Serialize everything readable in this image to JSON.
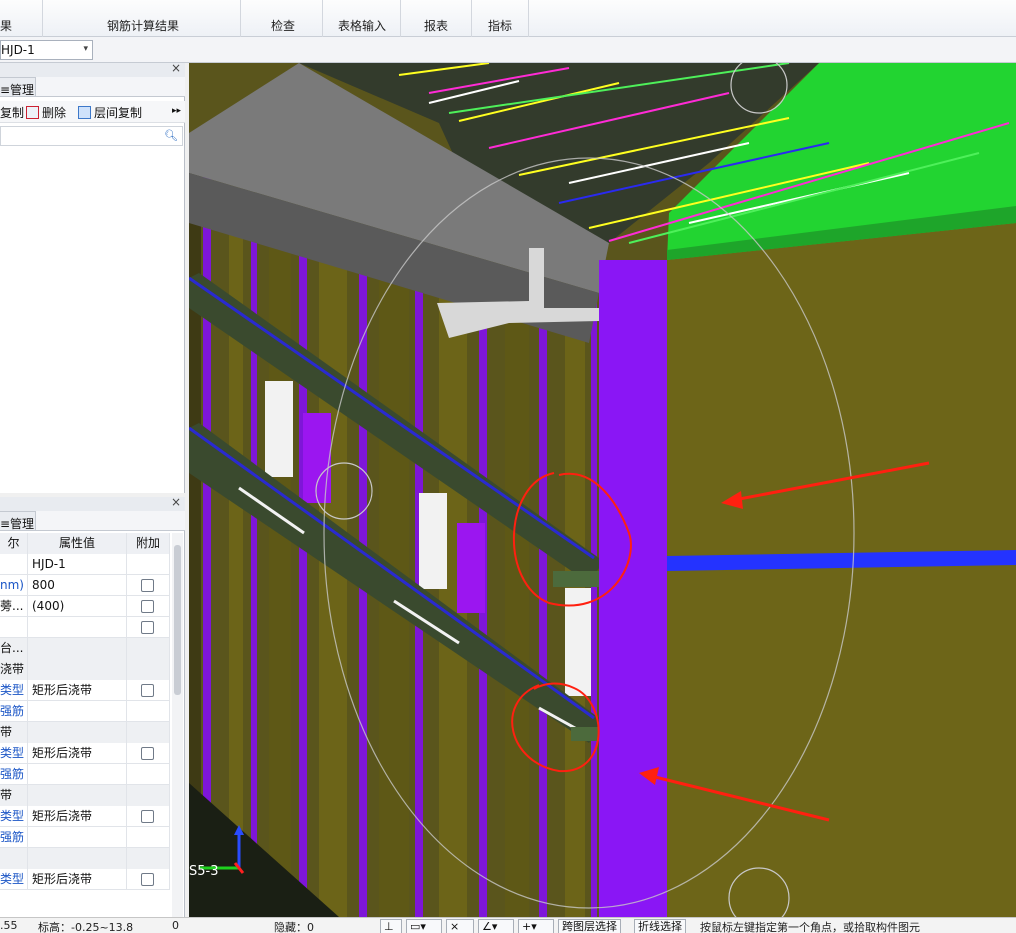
{
  "ribbon": {
    "groups": [
      {
        "label": "果"
      },
      {
        "label": "钢筋计算结果"
      },
      {
        "label": "检查"
      },
      {
        "label": "表格输入"
      },
      {
        "label": "报表"
      },
      {
        "label": "指标"
      }
    ]
  },
  "element_selector": {
    "value": "HJD-1",
    "icon": "chevron-down-icon"
  },
  "top_panel": {
    "tab": "≡管理",
    "close": "×",
    "tools": [
      {
        "label": "复制",
        "icon": "copy-icon"
      },
      {
        "label": "删除",
        "icon": "delete-icon"
      },
      {
        "label": "层间复制",
        "icon": "floor-copy-icon"
      }
    ],
    "more": "▸▸",
    "search_icon": "search-icon"
  },
  "bottom_panel": {
    "tab": "≡管理",
    "close": "×",
    "headers": [
      "尔",
      "属性值",
      "附加"
    ],
    "rows": [
      {
        "name": "",
        "value": "HJD-1",
        "name_blue": false,
        "checkbox": false,
        "shaded": false
      },
      {
        "name": "nm)",
        "value": "800",
        "name_blue": true,
        "checkbox": true,
        "shaded": false
      },
      {
        "name": "蒡...",
        "value": "(400)",
        "name_blue": false,
        "checkbox": true,
        "shaded": false
      },
      {
        "name": "",
        "value": "",
        "name_blue": false,
        "checkbox": true,
        "shaded": false
      },
      {
        "name": "台...",
        "value": "",
        "name_blue": false,
        "checkbox": false,
        "shaded": true
      },
      {
        "name": "浇带",
        "value": "",
        "name_blue": false,
        "checkbox": false,
        "shaded": true
      },
      {
        "name": "类型",
        "value": "矩形后浇带",
        "name_blue": true,
        "checkbox": true,
        "shaded": false
      },
      {
        "name": "强筋",
        "value": "",
        "name_blue": true,
        "checkbox": false,
        "shaded": false
      },
      {
        "name": "带",
        "value": "",
        "name_blue": false,
        "checkbox": false,
        "shaded": true
      },
      {
        "name": "类型",
        "value": "矩形后浇带",
        "name_blue": true,
        "checkbox": true,
        "shaded": false
      },
      {
        "name": "强筋",
        "value": "",
        "name_blue": true,
        "checkbox": false,
        "shaded": false
      },
      {
        "name": "带",
        "value": "",
        "name_blue": false,
        "checkbox": false,
        "shaded": true
      },
      {
        "name": "类型",
        "value": "矩形后浇带",
        "name_blue": true,
        "checkbox": true,
        "shaded": false
      },
      {
        "name": "强筋",
        "value": "",
        "name_blue": true,
        "checkbox": false,
        "shaded": false
      },
      {
        "name": "",
        "value": "",
        "name_blue": false,
        "checkbox": false,
        "shaded": true
      },
      {
        "name": "类型",
        "value": "矩形后浇带",
        "name_blue": true,
        "checkbox": true,
        "shaded": false
      }
    ]
  },
  "viewport": {
    "axis_label": "S5-3",
    "colors": {
      "wall": "#6d6518",
      "slab_top": "#22d431",
      "purple": "#8a16f5",
      "beam": "#3a4a2e",
      "annotation_red": "#ff2010",
      "blue_bar": "#2433ff"
    }
  },
  "status": {
    "left_value": ".55",
    "elevation": "标高：-0.25~13.8",
    "zero": "0",
    "hidden": "隐藏：0",
    "btn_layer": "跨图层选择",
    "btn_poly": "折线选择",
    "hint": "按鼠标左键指定第一个角点，或拾取构件图元"
  }
}
